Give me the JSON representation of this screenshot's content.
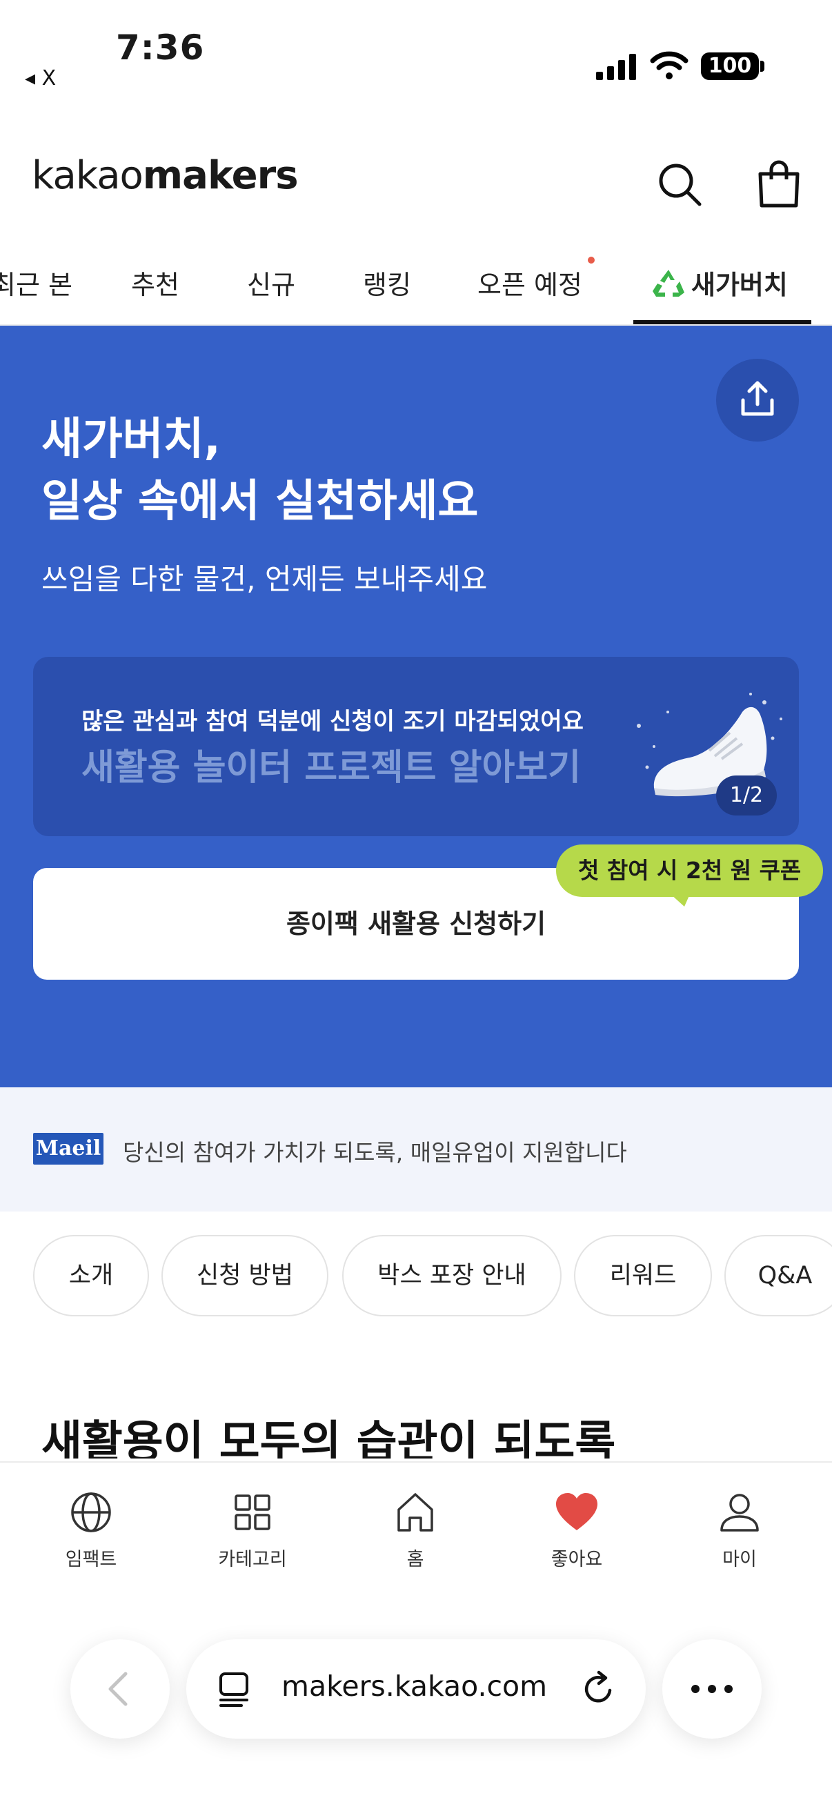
{
  "status_bar": {
    "time": "7:36",
    "back_app": "◂ X",
    "battery": "100",
    "icons": [
      "signal-icon",
      "wifi-icon",
      "battery-icon"
    ]
  },
  "header": {
    "logo_light": "kakao",
    "logo_bold": "makers",
    "icons": [
      "search-icon",
      "shopping-bag-icon"
    ]
  },
  "tabs": [
    {
      "label": "최근 본"
    },
    {
      "label": "추천"
    },
    {
      "label": "신규"
    },
    {
      "label": "랭킹"
    },
    {
      "label": "오픈 예정"
    },
    {
      "label": "새가버치",
      "active": true,
      "icon": "recycle-icon"
    }
  ],
  "hero": {
    "title_line1": "새가버치,",
    "title_line2": "일상 속에서 실천하세요",
    "subtitle": "쓰임을 다한 물건, 언제든 보내주세요",
    "banner_line1": "많은 관심과 참여 덕분에 신청이 조기 마감되었어요",
    "banner_line2": "새활용 놀이터 프로젝트 알아보기",
    "pager": "1/2",
    "cta_label": "종이팩 새활용 신청하기",
    "coupon_label": "첫 참여 시 2천 원 쿠폰",
    "share_icon": "share-icon"
  },
  "sponsor": {
    "logo_text": "Maeil",
    "text": "당신의 참여가 가치가 되도록, 매일유업이 지원합니다"
  },
  "chips": [
    "소개",
    "신청 방법",
    "박스 포장 안내",
    "리워드",
    "Q&A"
  ],
  "section_heading": "새활용이 모두의 습관이 되도록",
  "bottom_nav": [
    {
      "label": "임팩트",
      "icon": "globe-icon"
    },
    {
      "label": "카테고리",
      "icon": "grid-icon"
    },
    {
      "label": "홈",
      "icon": "home-icon"
    },
    {
      "label": "좋아요",
      "icon": "heart-icon"
    },
    {
      "label": "마이",
      "icon": "person-icon"
    }
  ],
  "browser": {
    "url": "makers.kakao.com",
    "icons": [
      "back-arrow-icon",
      "reader-icon",
      "reload-icon",
      "more-icon"
    ]
  },
  "colors": {
    "hero_bg": "#3560c8",
    "banner_bg": "#2b4fae",
    "coupon_bg": "#b6d94a",
    "like_red": "#e24b45",
    "sponsor_bg": "#f2f4fb",
    "recycle_green": "#3bb44a"
  }
}
